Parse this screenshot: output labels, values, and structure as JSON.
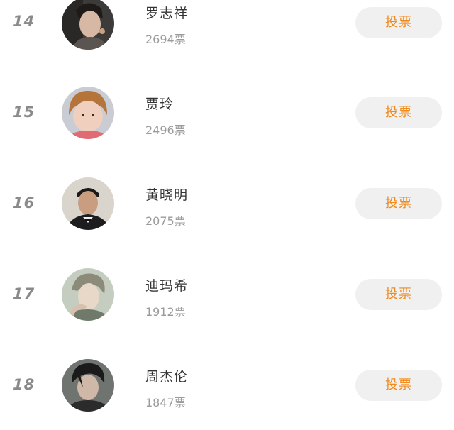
{
  "accent_color": "#f08a1c",
  "ranking": {
    "items": [
      {
        "rank": "14",
        "name": "罗志祥",
        "votes": "2694",
        "unit": "票",
        "button_label": "投票",
        "avatar_icon": "avatar-photo"
      },
      {
        "rank": "15",
        "name": "贾玲",
        "votes": "2496",
        "unit": "票",
        "button_label": "投票",
        "avatar_icon": "avatar-photo"
      },
      {
        "rank": "16",
        "name": "黄晓明",
        "votes": "2075",
        "unit": "票",
        "button_label": "投票",
        "avatar_icon": "avatar-photo"
      },
      {
        "rank": "17",
        "name": "迪玛希",
        "votes": "1912",
        "unit": "票",
        "button_label": "投票",
        "avatar_icon": "avatar-photo"
      },
      {
        "rank": "18",
        "name": "周杰伦",
        "votes": "1847",
        "unit": "票",
        "button_label": "投票",
        "avatar_icon": "avatar-photo"
      }
    ]
  }
}
